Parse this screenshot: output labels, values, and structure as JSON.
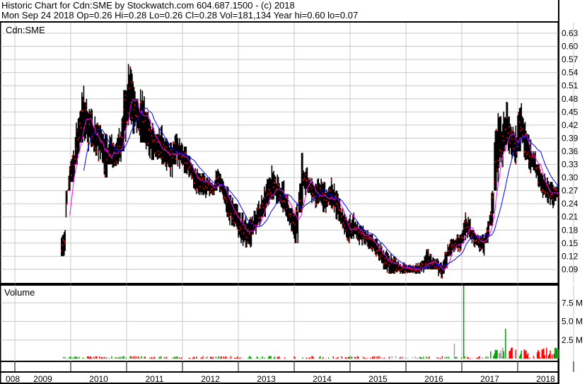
{
  "header": {
    "line1": "Historic Chart for Cdn:SME by Stockwatch.com 604.687.1500 - (c) 2018",
    "line2": "Mon Sep 24 2018  Op=0.26  Hi=0.28  Lo=0.26  Cl=0.28  Vol=181,134  Year hi=0.60  lo=0.07"
  },
  "chart_data": [
    {
      "type": "bar",
      "title": "Cdn:SME",
      "subtype": "ohlc",
      "ylim": [
        0.07,
        0.65
      ],
      "yticks": [
        "0.63",
        "0.60",
        "0.57",
        "0.54",
        "0.51",
        "0.48",
        "0.45",
        "0.42",
        "0.39",
        "0.36",
        "0.33",
        "0.30",
        "0.27",
        "0.24",
        "0.21",
        "0.18",
        "0.15",
        "0.12",
        "0.09"
      ],
      "xticks": [
        "008",
        "2009",
        "2010",
        "2011",
        "2012",
        "2013",
        "2014",
        "2015",
        "2016",
        "2017",
        "2018"
      ],
      "grid": true,
      "colors": {
        "bar": "#000000",
        "close": "#ff0000",
        "ma_short": "#ff00ff",
        "ma_long": "#0000ff"
      },
      "columns": [
        "month",
        "high",
        "low",
        "close"
      ],
      "rows": [
        [
          "2009-11",
          0.18,
          0.12,
          0.15
        ],
        [
          "2009-12",
          0.33,
          0.27,
          0.3
        ],
        [
          "2010-01",
          0.38,
          0.29,
          0.33
        ],
        [
          "2010-02",
          0.45,
          0.33,
          0.4
        ],
        [
          "2010-03",
          0.51,
          0.38,
          0.44
        ],
        [
          "2010-04",
          0.48,
          0.36,
          0.42
        ],
        [
          "2010-05",
          0.46,
          0.37,
          0.4
        ],
        [
          "2010-06",
          0.44,
          0.35,
          0.39
        ],
        [
          "2010-07",
          0.42,
          0.33,
          0.38
        ],
        [
          "2010-08",
          0.4,
          0.3,
          0.34
        ],
        [
          "2010-09",
          0.41,
          0.33,
          0.36
        ],
        [
          "2010-10",
          0.38,
          0.32,
          0.35
        ],
        [
          "2010-11",
          0.42,
          0.33,
          0.38
        ],
        [
          "2010-12",
          0.5,
          0.36,
          0.45
        ],
        [
          "2011-01",
          0.6,
          0.42,
          0.5
        ],
        [
          "2011-02",
          0.55,
          0.4,
          0.46
        ],
        [
          "2011-03",
          0.48,
          0.38,
          0.42
        ],
        [
          "2011-04",
          0.52,
          0.38,
          0.43
        ],
        [
          "2011-05",
          0.45,
          0.35,
          0.4
        ],
        [
          "2011-06",
          0.43,
          0.34,
          0.38
        ],
        [
          "2011-07",
          0.4,
          0.33,
          0.36
        ],
        [
          "2011-08",
          0.42,
          0.33,
          0.37
        ],
        [
          "2011-09",
          0.39,
          0.31,
          0.35
        ],
        [
          "2011-10",
          0.38,
          0.3,
          0.34
        ],
        [
          "2011-11",
          0.4,
          0.33,
          0.37
        ],
        [
          "2011-12",
          0.39,
          0.32,
          0.35
        ],
        [
          "2012-01",
          0.38,
          0.31,
          0.34
        ],
        [
          "2012-02",
          0.35,
          0.29,
          0.32
        ],
        [
          "2012-03",
          0.33,
          0.27,
          0.3
        ],
        [
          "2012-04",
          0.32,
          0.26,
          0.29
        ],
        [
          "2012-05",
          0.31,
          0.26,
          0.28
        ],
        [
          "2012-06",
          0.3,
          0.25,
          0.28
        ],
        [
          "2012-07",
          0.29,
          0.26,
          0.27
        ],
        [
          "2012-08",
          0.33,
          0.27,
          0.3
        ],
        [
          "2012-09",
          0.31,
          0.25,
          0.27
        ],
        [
          "2012-10",
          0.28,
          0.21,
          0.24
        ],
        [
          "2012-11",
          0.26,
          0.19,
          0.22
        ],
        [
          "2012-12",
          0.24,
          0.18,
          0.21
        ],
        [
          "2013-01",
          0.22,
          0.15,
          0.18
        ],
        [
          "2013-02",
          0.22,
          0.14,
          0.17
        ],
        [
          "2013-03",
          0.21,
          0.14,
          0.18
        ],
        [
          "2013-04",
          0.23,
          0.17,
          0.2
        ],
        [
          "2013-05",
          0.25,
          0.19,
          0.22
        ],
        [
          "2013-06",
          0.28,
          0.21,
          0.25
        ],
        [
          "2013-07",
          0.3,
          0.23,
          0.27
        ],
        [
          "2013-08",
          0.34,
          0.25,
          0.28
        ],
        [
          "2013-09",
          0.31,
          0.24,
          0.26
        ],
        [
          "2013-10",
          0.3,
          0.22,
          0.25
        ],
        [
          "2013-11",
          0.26,
          0.2,
          0.22
        ],
        [
          "2013-12",
          0.23,
          0.17,
          0.2
        ],
        [
          "2014-01",
          0.24,
          0.15,
          0.19
        ],
        [
          "2014-02",
          0.37,
          0.22,
          0.3
        ],
        [
          "2014-03",
          0.33,
          0.26,
          0.29
        ],
        [
          "2014-04",
          0.3,
          0.24,
          0.27
        ],
        [
          "2014-05",
          0.29,
          0.23,
          0.26
        ],
        [
          "2014-06",
          0.3,
          0.24,
          0.27
        ],
        [
          "2014-07",
          0.29,
          0.22,
          0.25
        ],
        [
          "2014-08",
          0.28,
          0.23,
          0.26
        ],
        [
          "2014-09",
          0.3,
          0.22,
          0.25
        ],
        [
          "2014-10",
          0.27,
          0.2,
          0.22
        ],
        [
          "2014-11",
          0.23,
          0.17,
          0.19
        ],
        [
          "2014-12",
          0.21,
          0.15,
          0.18
        ],
        [
          "2015-01",
          0.22,
          0.16,
          0.19
        ],
        [
          "2015-02",
          0.2,
          0.15,
          0.17
        ],
        [
          "2015-03",
          0.19,
          0.14,
          0.17
        ],
        [
          "2015-04",
          0.18,
          0.14,
          0.16
        ],
        [
          "2015-05",
          0.17,
          0.13,
          0.15
        ],
        [
          "2015-06",
          0.16,
          0.12,
          0.14
        ],
        [
          "2015-07",
          0.15,
          0.1,
          0.12
        ],
        [
          "2015-08",
          0.14,
          0.09,
          0.11
        ],
        [
          "2015-09",
          0.13,
          0.08,
          0.1
        ],
        [
          "2015-10",
          0.12,
          0.08,
          0.1
        ],
        [
          "2015-11",
          0.11,
          0.08,
          0.09
        ],
        [
          "2015-12",
          0.11,
          0.08,
          0.09
        ],
        [
          "2016-01",
          0.1,
          0.08,
          0.09
        ],
        [
          "2016-02",
          0.1,
          0.08,
          0.09
        ],
        [
          "2016-03",
          0.11,
          0.08,
          0.09
        ],
        [
          "2016-04",
          0.11,
          0.08,
          0.1
        ],
        [
          "2016-05",
          0.14,
          0.09,
          0.11
        ],
        [
          "2016-06",
          0.13,
          0.09,
          0.1
        ],
        [
          "2016-07",
          0.12,
          0.09,
          0.1
        ],
        [
          "2016-08",
          0.11,
          0.07,
          0.08
        ],
        [
          "2016-09",
          0.13,
          0.08,
          0.12
        ],
        [
          "2016-10",
          0.16,
          0.12,
          0.14
        ],
        [
          "2016-11",
          0.16,
          0.13,
          0.15
        ],
        [
          "2016-12",
          0.17,
          0.13,
          0.15
        ],
        [
          "2017-01",
          0.22,
          0.15,
          0.19
        ],
        [
          "2017-02",
          0.21,
          0.16,
          0.18
        ],
        [
          "2017-03",
          0.18,
          0.14,
          0.16
        ],
        [
          "2017-04",
          0.17,
          0.13,
          0.15
        ],
        [
          "2017-05",
          0.17,
          0.12,
          0.15
        ],
        [
          "2017-06",
          0.2,
          0.15,
          0.18
        ],
        [
          "2017-07",
          0.28,
          0.19,
          0.24
        ],
        [
          "2017-08",
          0.46,
          0.27,
          0.38
        ],
        [
          "2017-09",
          0.44,
          0.32,
          0.38
        ],
        [
          "2017-10",
          0.5,
          0.36,
          0.42
        ],
        [
          "2017-11",
          0.44,
          0.34,
          0.38
        ],
        [
          "2017-12",
          0.42,
          0.33,
          0.37
        ],
        [
          "2018-01",
          0.47,
          0.36,
          0.42
        ],
        [
          "2018-02",
          0.44,
          0.34,
          0.38
        ],
        [
          "2018-03",
          0.4,
          0.31,
          0.34
        ],
        [
          "2018-04",
          0.36,
          0.3,
          0.33
        ],
        [
          "2018-05",
          0.33,
          0.27,
          0.3
        ],
        [
          "2018-06",
          0.31,
          0.25,
          0.28
        ],
        [
          "2018-07",
          0.3,
          0.24,
          0.27
        ],
        [
          "2018-08",
          0.29,
          0.23,
          0.26
        ],
        [
          "2018-09",
          0.28,
          0.24,
          0.27
        ]
      ]
    },
    {
      "type": "bar",
      "title": "Volume",
      "ylim": [
        0,
        10
      ],
      "yticks": [
        "7.5 M",
        "5.0 M",
        "2.5 M"
      ],
      "unit": "M",
      "colors": {
        "up": "#00a000",
        "down": "#ff0000",
        "flat": "#a0a0a0"
      },
      "peaks": [
        [
          "2016-11",
          2.0
        ],
        [
          "2017-01",
          9.8
        ],
        [
          "2017-10",
          4.0
        ]
      ]
    }
  ]
}
